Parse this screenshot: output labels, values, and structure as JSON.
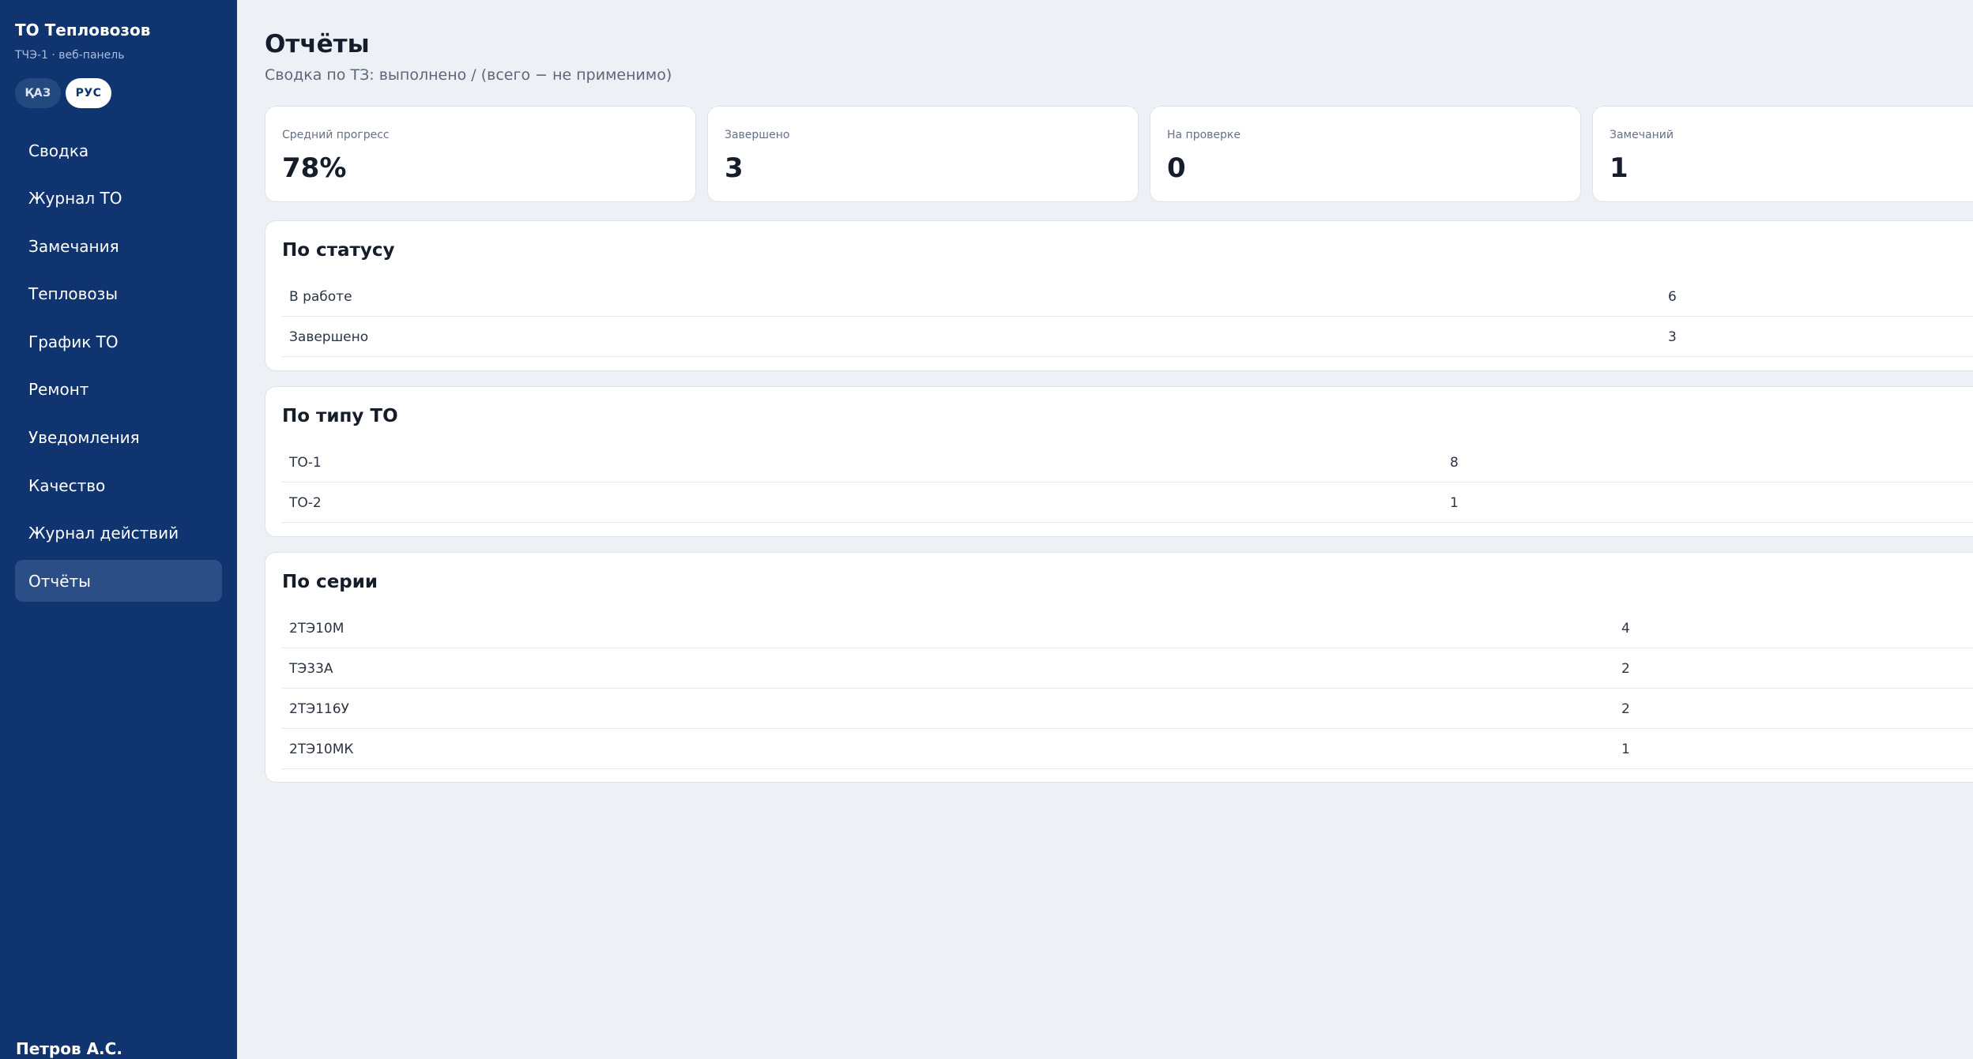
{
  "sidebar": {
    "brand_title": "ТО Тепловозов",
    "brand_subtitle": "ТЧЭ-1 · веб-панель",
    "lang": {
      "kaz": "ҚАЗ",
      "rus": "РУС",
      "active": "rus"
    },
    "items": [
      {
        "label": "Сводка"
      },
      {
        "label": "Журнал ТО"
      },
      {
        "label": "Замечания"
      },
      {
        "label": "Тепловозы"
      },
      {
        "label": "График ТО"
      },
      {
        "label": "Ремонт"
      },
      {
        "label": "Уведомления"
      },
      {
        "label": "Качество"
      },
      {
        "label": "Журнал действий"
      },
      {
        "label": "Отчёты",
        "active": true
      }
    ],
    "user": "Петров А.С."
  },
  "main": {
    "title": "Отчёты",
    "subtitle": "Сводка по ТЗ: выполнено / (всего − не применимо)",
    "stats": [
      {
        "label": "Средний прогресс",
        "value": "78%"
      },
      {
        "label": "Завершено",
        "value": "3"
      },
      {
        "label": "На проверке",
        "value": "0"
      },
      {
        "label": "Замечаний",
        "value": "1"
      }
    ],
    "by_status": {
      "title": "По статусу",
      "rows": [
        {
          "label": "В работе",
          "value": "6"
        },
        {
          "label": "Завершено",
          "value": "3"
        }
      ]
    },
    "by_type": {
      "title": "По типу ТО",
      "rows": [
        {
          "label": "ТО-1",
          "value": "8"
        },
        {
          "label": "ТО-2",
          "value": "1"
        }
      ]
    },
    "by_series": {
      "title": "По серии",
      "rows": [
        {
          "label": "2ТЭ10М",
          "value": "4"
        },
        {
          "label": "ТЭ33А",
          "value": "2"
        },
        {
          "label": "2ТЭ116У",
          "value": "2"
        },
        {
          "label": "2ТЭ10МК",
          "value": "1"
        }
      ]
    }
  },
  "colors": {
    "sidebar_bg": "#0f3470",
    "sidebar_active": "#2c4e86",
    "page_bg": "#edf0f5",
    "card_bg": "#ffffff"
  }
}
